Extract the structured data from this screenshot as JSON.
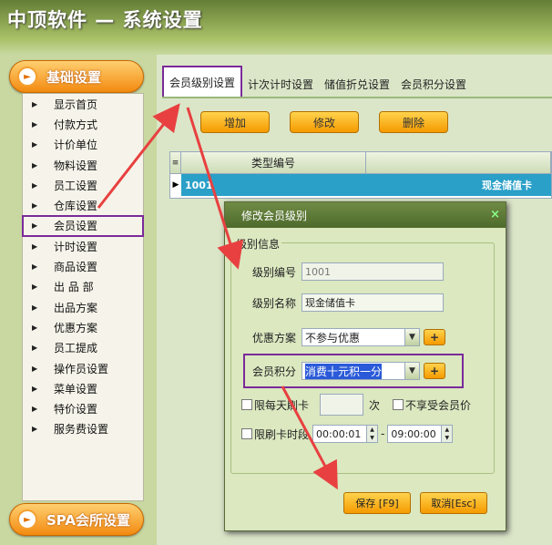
{
  "app": {
    "title": "中顶软件 — 系统设置"
  },
  "sidebar": {
    "top_button": "基础设置",
    "bottom_button": "SPA会所设置",
    "items": [
      "显示首页",
      "付款方式",
      "计价单位",
      "物料设置",
      "员工设置",
      "仓库设置",
      "会员设置",
      "计时设置",
      "商品设置",
      "出 品 部",
      "出品方案",
      "优惠方案",
      "员工提成",
      "操作员设置",
      "菜单设置",
      "特价设置",
      "服务费设置"
    ]
  },
  "tabs": [
    "会员级别设置",
    "计次计时设置",
    "储值折兑设置",
    "会员积分设置"
  ],
  "toolbar": {
    "add": "增加",
    "edit": "修改",
    "delete": "删除"
  },
  "grid": {
    "header_col1": "类型编号",
    "header_col2": "",
    "row": {
      "code": "1001",
      "name": "现金储值卡"
    }
  },
  "dialog": {
    "title": "修改会员级别",
    "close": "×",
    "group_label": "级别信息",
    "level_code_label": "级别编号",
    "level_code_value": "1001",
    "level_name_label": "级别名称",
    "level_name_value": "现金储值卡",
    "discount_label": "优惠方案",
    "discount_value": "不参与优惠",
    "points_label": "会员积分",
    "points_value": "消费十元积一分",
    "plus": "+",
    "daily_limit_label": "限每天刷卡",
    "daily_limit_unit": "次",
    "no_member_price_label": "不享受会员价",
    "time_limit_label": "限刷卡时段",
    "time_start": "00:00:01",
    "time_sep": "-",
    "time_end": "09:00:00",
    "save": "保存 [F9]",
    "cancel": "取消[Esc]"
  },
  "colors": {
    "accent_orange": "#f59a00",
    "highlight_purple": "#7a2a9a",
    "arrow_red": "#e84040",
    "grid_row": "#2aa0c8"
  }
}
